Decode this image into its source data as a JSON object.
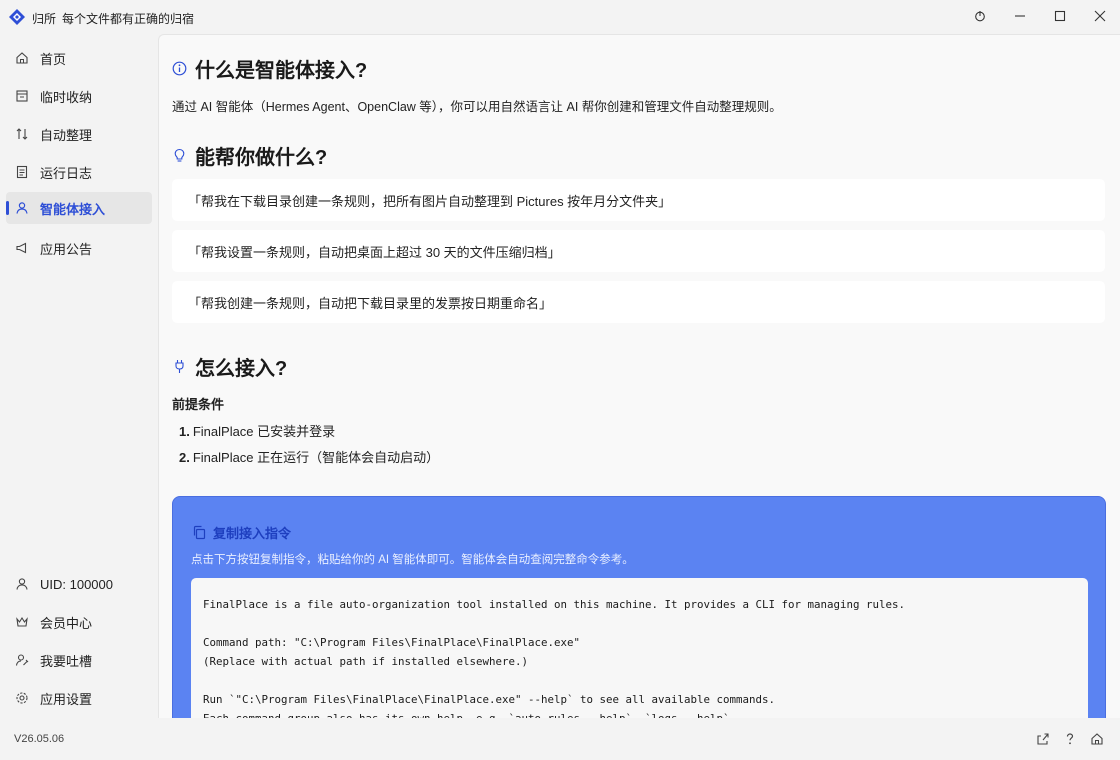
{
  "titlebar": {
    "app_name": "归所",
    "slogan": "每个文件都有正确的归宿",
    "buttons": [
      "pin-icon",
      "minimize-icon",
      "maximize-icon",
      "close-icon"
    ]
  },
  "sidebar": {
    "items": [
      {
        "label": "首页",
        "icon": "home-icon"
      },
      {
        "label": "临时收纳",
        "icon": "inbox-icon"
      },
      {
        "label": "自动整理",
        "icon": "sort-icon"
      },
      {
        "label": "运行日志",
        "icon": "log-icon"
      },
      {
        "label": "智能体接入",
        "icon": "agent-icon",
        "active": true
      },
      {
        "label": "应用公告",
        "icon": "megaphone-icon"
      }
    ],
    "bottom_items": [
      {
        "label": "UID: 100000",
        "icon": "user-icon"
      },
      {
        "label": "会员中心",
        "icon": "crown-icon"
      },
      {
        "label": "我要吐槽",
        "icon": "feedback-icon"
      },
      {
        "label": "应用设置",
        "icon": "settings-icon"
      }
    ]
  },
  "footer": {
    "version": "V26.05.06"
  },
  "main": {
    "section1": {
      "title": "什么是智能体接入?",
      "text": "通过 AI 智能体（Hermes Agent、OpenClaw 等），你可以用自然语言让 AI 帮你创建和管理文件自动整理规则。"
    },
    "section2": {
      "title": "能帮你做什么?",
      "examples": [
        "「帮我在下载目录创建一条规则，把所有图片自动整理到 Pictures 按年月分文件夹」",
        "「帮我设置一条规则，自动把桌面上超过 30 天的文件压缩归档」",
        "「帮我创建一条规则，自动把下载目录里的发票按日期重命名」"
      ]
    },
    "section3": {
      "title": "怎么接入?",
      "prereq_title": "前提条件",
      "steps": [
        {
          "num": "1.",
          "text": "FinalPlace 已安装并登录"
        },
        {
          "num": "2.",
          "text": "FinalPlace 正在运行（智能体会自动启动）"
        }
      ]
    },
    "copy_card": {
      "title": "复制接入指令",
      "desc": "点击下方按钮复制指令，粘贴给你的 AI 智能体即可。智能体会自动查阅完整命令参考。",
      "code": "FinalPlace is a file auto-organization tool installed on this machine. It provides a CLI for managing rules.\n\nCommand path: \"C:\\Program Files\\FinalPlace\\FinalPlace.exe\"\n(Replace with actual path if installed elsewhere.)\n\nRun `\"C:\\Program Files\\FinalPlace\\FinalPlace.exe\" --help` to see all available commands.\nEach command group also has its own help, e.g. `auto-rules --help`, `logs --help`."
    }
  },
  "colors": {
    "accent": "#2e4fd6",
    "card_bg": "#5b83f2",
    "window_bg": "#f3f3f3",
    "content_bg": "#f9f9f9"
  }
}
